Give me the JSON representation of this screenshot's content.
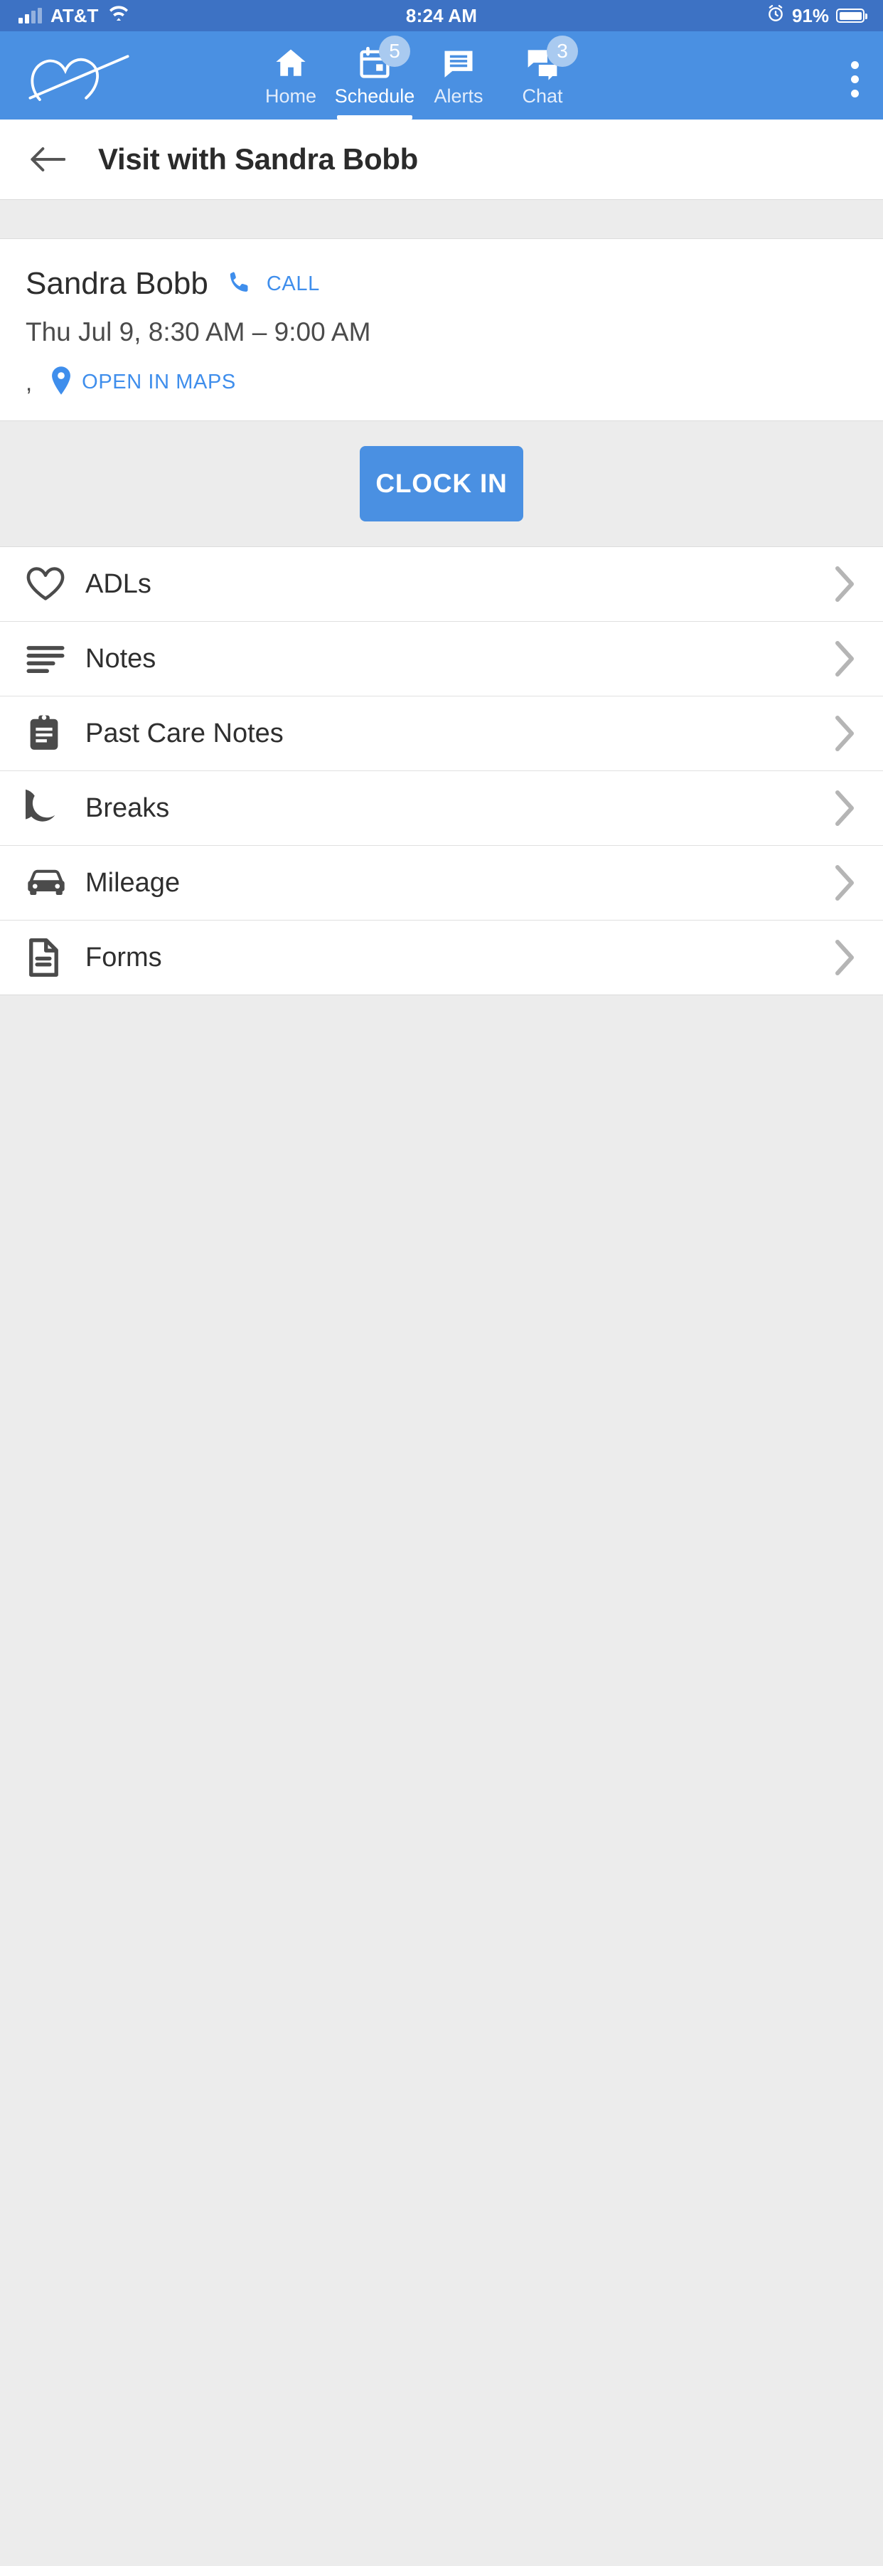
{
  "status_bar": {
    "carrier": "AT&T",
    "time": "8:24 AM",
    "battery": "91%"
  },
  "nav": {
    "tabs": [
      {
        "label": "Home",
        "icon": "home-icon",
        "badge": "",
        "active": false
      },
      {
        "label": "Schedule",
        "icon": "calendar-icon",
        "badge": "5",
        "active": true
      },
      {
        "label": "Alerts",
        "icon": "message-icon",
        "badge": "",
        "active": false
      },
      {
        "label": "Chat",
        "icon": "chat-icon",
        "badge": "3",
        "active": false
      }
    ],
    "overflow_icon": "kebab-menu-icon",
    "logo_icon": "heart-logo-icon"
  },
  "header": {
    "back_icon": "back-arrow-icon",
    "title": "Visit with Sandra Bobb"
  },
  "visit": {
    "client_name": "Sandra Bobb",
    "call_label": "CALL",
    "call_icon": "phone-icon",
    "datetime": "Thu Jul 9, 8:30 AM – 9:00 AM",
    "address": ",",
    "map_label": "OPEN IN MAPS",
    "map_icon": "map-pin-icon"
  },
  "clock": {
    "button_label": "CLOCK IN"
  },
  "menu": {
    "items": [
      {
        "label": "ADLs",
        "icon": "heart-outline-icon"
      },
      {
        "label": "Notes",
        "icon": "notes-lines-icon"
      },
      {
        "label": "Past Care Notes",
        "icon": "clipboard-icon"
      },
      {
        "label": "Breaks",
        "icon": "moon-icon"
      },
      {
        "label": "Mileage",
        "icon": "car-icon"
      },
      {
        "label": "Forms",
        "icon": "document-icon"
      }
    ],
    "chevron_icon": "chevron-right-icon"
  },
  "colors": {
    "status_bar_blue": "#3d72c4",
    "nav_blue": "#4a90e2",
    "accent_blue": "#3f8eec",
    "badge_blue": "#a9caf0",
    "page_bg": "#ececec",
    "text_dark": "#2d2d2d"
  }
}
